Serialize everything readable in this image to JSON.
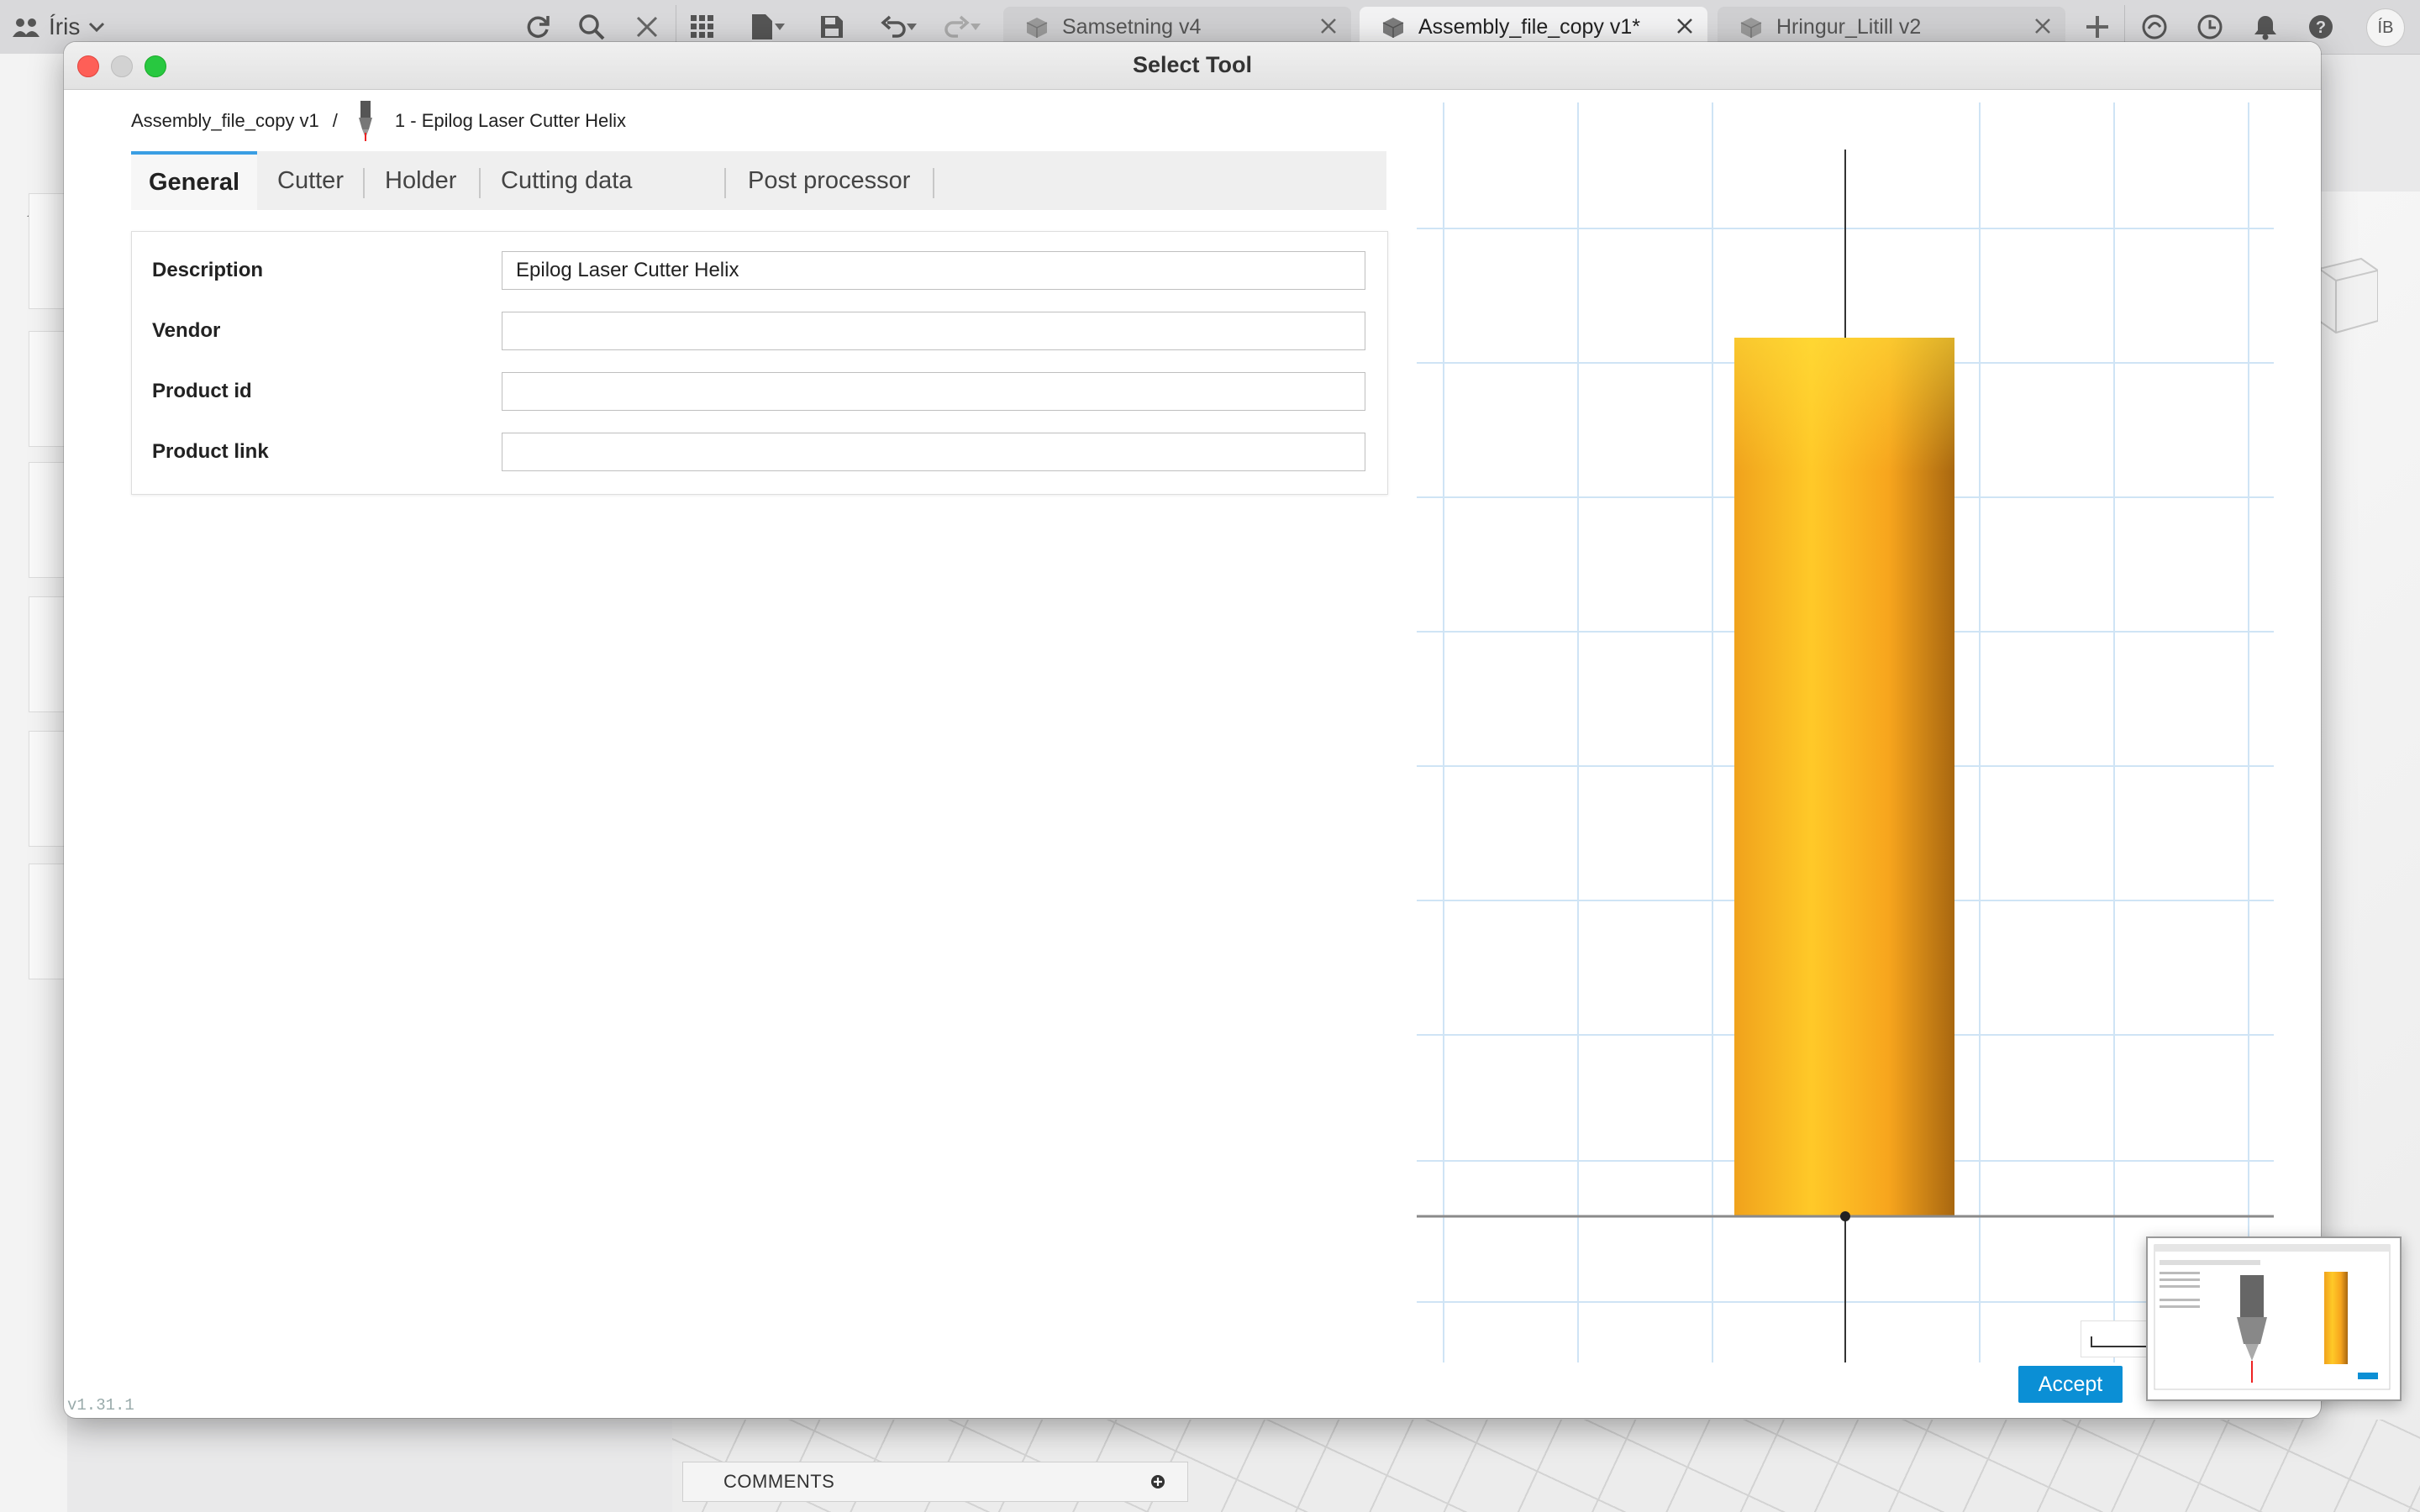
{
  "appbar": {
    "team_label": "Íris",
    "tabs": [
      {
        "label": "Samsetning v4",
        "active": false
      },
      {
        "label": "Assembly_file_copy v1*",
        "active": true
      },
      {
        "label": "Hringur_Litill v2",
        "active": false
      }
    ],
    "avatar_initials": "ÍB"
  },
  "dialog": {
    "title": "Select Tool",
    "breadcrumb": {
      "document": "Assembly_file_copy v1",
      "separator": "/",
      "tool": "1 - Epilog Laser Cutter Helix"
    },
    "tabs": [
      "General",
      "Cutter",
      "Holder",
      "Cutting data",
      "Post processor"
    ],
    "active_tab": "General",
    "fields": [
      {
        "label": "Description",
        "value": "Epilog Laser Cutter Helix"
      },
      {
        "label": "Vendor",
        "value": ""
      },
      {
        "label": "Product id",
        "value": ""
      },
      {
        "label": "Product link",
        "value": ""
      }
    ],
    "accept_label": "Accept",
    "version": "v1.31.1"
  },
  "comments_label": "COMMENTS",
  "colors": {
    "accent": "#0b8fd5",
    "tab_active_border": "#3a9ee3",
    "tool_body": "#f5a623"
  },
  "icons": [
    "people-icon",
    "chevron-down-icon",
    "refresh-icon",
    "search-icon",
    "close-icon",
    "grid-icon",
    "file-icon",
    "save-icon",
    "undo-icon",
    "redo-icon",
    "cube-icon",
    "plus-icon",
    "extensions-icon",
    "job-status-icon",
    "notification-icon",
    "help-icon",
    "home-icon",
    "tool-icon"
  ]
}
